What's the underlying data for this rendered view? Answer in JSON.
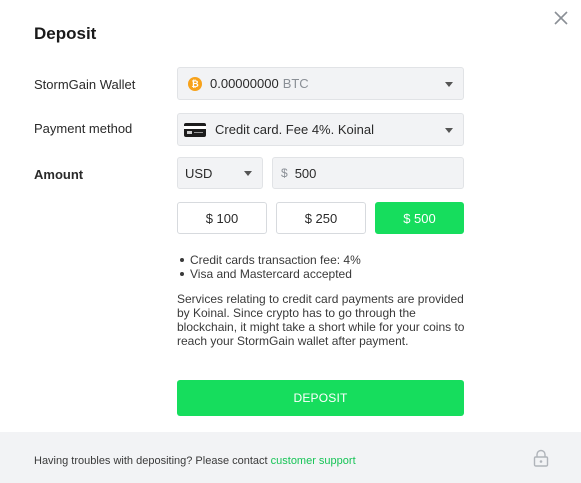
{
  "title": "Deposit",
  "wallet": {
    "label": "StormGain Wallet",
    "amount": "0.00000000",
    "currency": "BTC",
    "coin_icon": "bitcoin-icon",
    "coin_symbol": "₿"
  },
  "payment": {
    "label": "Payment method",
    "value": "Credit card. Fee 4%. Koinal",
    "icon": "credit-card-icon"
  },
  "amount": {
    "label": "Amount",
    "currency": "USD",
    "currency_symbol": "$",
    "value": "500"
  },
  "presets": [
    {
      "label": "$ 100",
      "selected": false
    },
    {
      "label": "$ 250",
      "selected": false
    },
    {
      "label": "$ 500",
      "selected": true
    }
  ],
  "info": {
    "bullets": [
      "Credit cards transaction fee: 4%",
      "Visa and Mastercard accepted"
    ],
    "paragraph_lines": [
      "Services relating to credit card payments are provided",
      "by Koinal. Since crypto has to go through the",
      "blockchain, it might take a short while for your coins to",
      "reach your StormGain wallet after payment."
    ]
  },
  "deposit_button": "DEPOSIT",
  "footer": {
    "text": "Having troubles with depositing? Please contact ",
    "link": "customer support"
  },
  "colors": {
    "accent": "#16dd5d",
    "link": "#16c456",
    "bitcoin": "#f7a21b",
    "field_bg": "#f2f3f5"
  }
}
